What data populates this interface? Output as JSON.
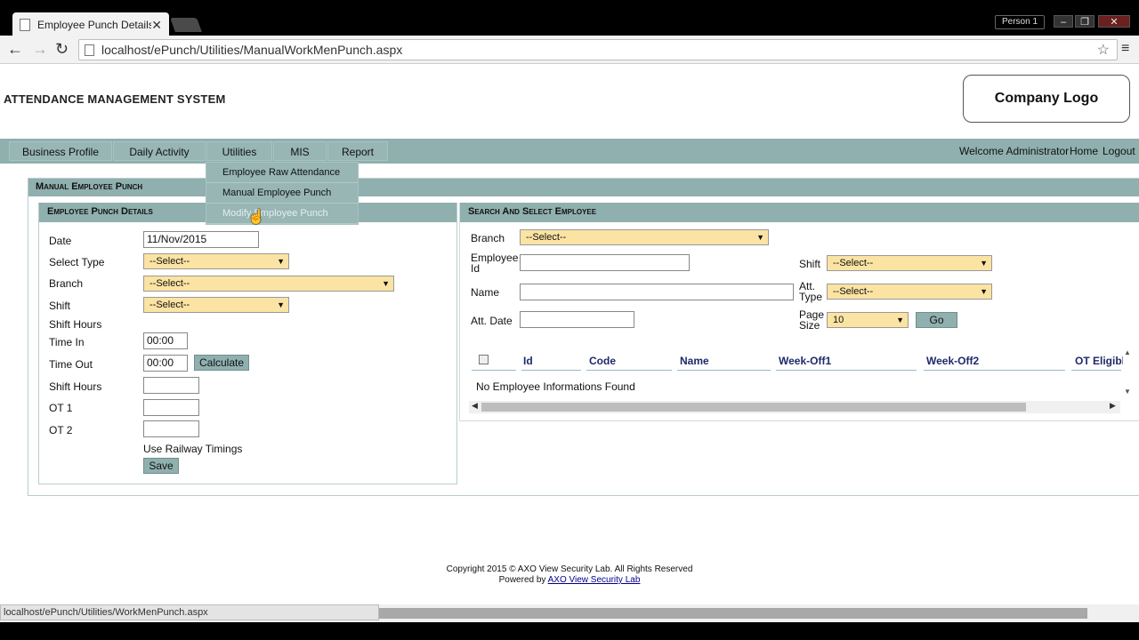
{
  "browser": {
    "tab_title": "Employee Punch Details",
    "tab_close": "✕",
    "url": "localhost/ePunch/Utilities/ManualWorkMenPunch.aspx",
    "profile": "Person 1",
    "status_url": "localhost/ePunch/Utilities/WorkMenPunch.aspx"
  },
  "header": {
    "app_title": "ATTENDANCE MANAGEMENT SYSTEM",
    "logo_text": "Company Logo"
  },
  "menu": {
    "items": [
      "Business Profile",
      "Daily Activity",
      "Utilities",
      "MIS",
      "Report"
    ],
    "welcome": "Welcome Administrator",
    "home": "Home",
    "logout": "Logout",
    "utilities_dropdown": [
      "Employee Raw Attendance",
      "Manual Employee Punch",
      "Modify Employee Punch"
    ]
  },
  "outer_panel": {
    "title": "Manual Employee Punch"
  },
  "left_panel": {
    "title": "Employee Punch Details",
    "labels": {
      "date": "Date",
      "select_type": "Select Type",
      "branch": "Branch",
      "shift": "Shift",
      "shift_hours_header": "Shift Hours",
      "time_in": "Time In",
      "time_out": "Time Out",
      "shift_hours": "Shift Hours",
      "ot1": "OT 1",
      "ot2": "OT 2",
      "railway": "Use Railway Timings"
    },
    "values": {
      "date": "11/Nov/2015",
      "select_type": "--Select--",
      "branch": "--Select--",
      "shift": "--Select--",
      "time_in": "00:00",
      "time_out": "00:00",
      "shift_hours": "",
      "ot1": "",
      "ot2": ""
    },
    "buttons": {
      "calculate": "Calculate",
      "save": "Save"
    }
  },
  "right_panel": {
    "title": "Search And Select Employee",
    "labels": {
      "branch": "Branch",
      "employee_id_1": "Employee",
      "employee_id_2": "Id",
      "name": "Name",
      "att_date": "Att. Date",
      "shift": "Shift",
      "att_type_1": "Att.",
      "att_type_2": "Type",
      "page_size_1": "Page",
      "page_size_2": "Size"
    },
    "values": {
      "branch": "--Select--",
      "employee_id": "",
      "name": "",
      "att_date": "",
      "shift": "--Select--",
      "att_type": "--Select--",
      "page_size": "10"
    },
    "buttons": {
      "go": "Go"
    },
    "grid": {
      "columns": [
        "Id",
        "Code",
        "Name",
        "Week-Off1",
        "Week-Off2",
        "OT Eligibl"
      ],
      "empty_message": "No Employee Informations Found"
    }
  },
  "footer": {
    "copyright": "Copyright 2015 © AXO View Security Lab. All Rights Reserved",
    "powered_by": "Powered by",
    "powered_link": "AXO View Security Lab"
  }
}
